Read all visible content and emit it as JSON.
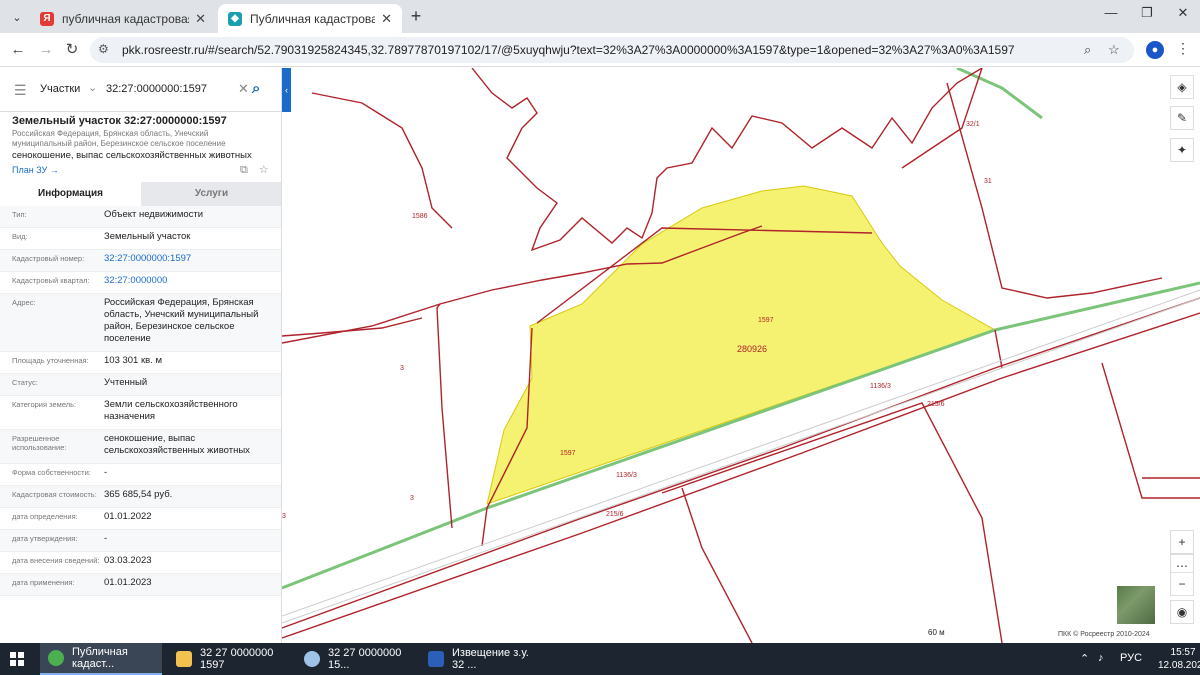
{
  "browser": {
    "tabs": [
      {
        "title": "публичная кадастровая карта",
        "favicon": "yandex-icon",
        "color": "#e53935",
        "active": false
      },
      {
        "title": "Публичная кадастровая карта",
        "favicon": "rosreestr-icon",
        "color": "#1a9fb0",
        "active": true
      }
    ],
    "url": "pkk.rosreestr.ru/#/search/52.79031925824345,32.78977870197102/17/@5xuyqhwju?text=32%3A27%3A0000000%3A1597&type=1&opened=32%3A27%3A0%3A1597"
  },
  "search": {
    "category": "Участки",
    "query": "32:27:0000000:1597"
  },
  "object": {
    "title": "Земельный участок 32:27:0000000:1597",
    "address": "Российская Федерация, Брянская область, Унечский муниципальный район, Березинское сельское поселение",
    "use": "сенокошение, выпас сельскохозяйственных животных",
    "plan_link": "План ЗУ →"
  },
  "tabs": {
    "info": "Информация",
    "services": "Услуги"
  },
  "attributes": [
    {
      "key": "Тип:",
      "value": "Объект недвижимости"
    },
    {
      "key": "Вид:",
      "value": "Земельный участок"
    },
    {
      "key": "Кадастровый номер:",
      "value": "32:27:0000000:1597",
      "link": true
    },
    {
      "key": "Кадастровый квартал:",
      "value": "32:27:0000000",
      "link": true
    },
    {
      "key": "Адрес:",
      "value": "Российская Федерация, Брянская область, Унечский муниципальный район, Березинское сельское поселение"
    },
    {
      "key": "Площадь уточненная:",
      "value": "103 301 кв. м"
    },
    {
      "key": "Статус:",
      "value": "Учтенный"
    },
    {
      "key": "Категория земель:",
      "value": "Земли сельскохозяйственного назначения"
    },
    {
      "key": "Разрешенное использование:",
      "value": "сенокошение, выпас сельскохозяйственных животных"
    },
    {
      "key": "Форма собственности:",
      "value": "-"
    },
    {
      "key": "Кадастровая стоимость:",
      "value": "365 685,54 руб."
    },
    {
      "key": "дата определения:",
      "value": "01.01.2022"
    },
    {
      "key": "дата утверждения:",
      "value": "-"
    },
    {
      "key": "дата внесения сведений:",
      "value": "03.03.2023"
    },
    {
      "key": "дата применения:",
      "value": "01.01.2023"
    }
  ],
  "map": {
    "labels": {
      "p1586": "1586",
      "p32_1": "32/1",
      "p31": "31",
      "p1597a": "1597",
      "p280926": "280926",
      "p3a": "3",
      "p1136_3a": "1136/3",
      "p215_6a": "215/6",
      "p1597b": "1597",
      "p1136_3b": "1136/3",
      "p3b": "3",
      "p3c": "3",
      "p215_6b": "215/6"
    },
    "scale": "60 м",
    "copyright": "ПКК © Росреестр 2010-2024",
    "parcel_fill": "#f5f26a",
    "boundary_color": "#b0232a",
    "road_color": "#7cc47a"
  },
  "taskbar": {
    "items": [
      {
        "label": "Публичная кадаст...",
        "icon": "chrome-icon",
        "color": "#4caf50"
      },
      {
        "label": "32 27 0000000 1597",
        "icon": "folder-icon",
        "color": "#f2c14e"
      },
      {
        "label": "32  27  0000000  15...",
        "icon": "paint-icon",
        "color": "#9ec3e6"
      },
      {
        "label": "Извещение з.у. 32 ...",
        "icon": "word-icon",
        "color": "#2b5fb8"
      }
    ],
    "lang": "РУС",
    "time": "15:57",
    "date": "12.08.2024"
  }
}
